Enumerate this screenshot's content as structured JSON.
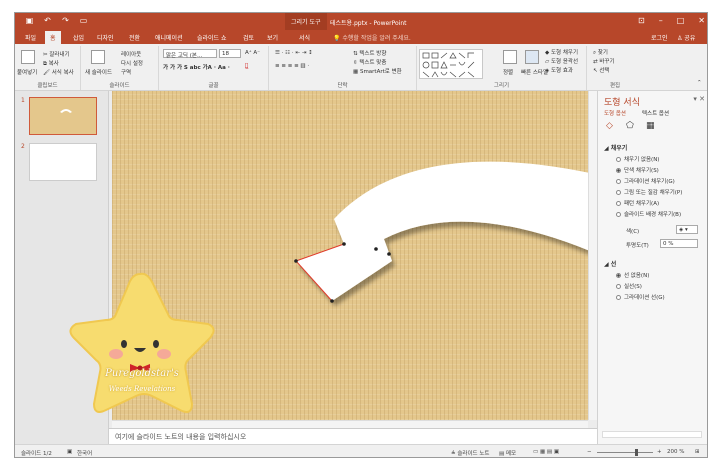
{
  "title_bar": {
    "context_tab": "그리기 도구",
    "doc_title": "테스트용.pptx - PowerPoint"
  },
  "tabs": [
    "파일",
    "홈",
    "삽입",
    "디자인",
    "전환",
    "애니메이션",
    "슬라이드 쇼",
    "검토",
    "보기",
    "서식"
  ],
  "active_tab": "홈",
  "tell_me": "수행할 작업을 알려 주세요.",
  "account": {
    "login": "로그인",
    "share": "공유"
  },
  "ribbon": {
    "clipboard": {
      "paste": "붙여넣기",
      "cut": "잘라내기",
      "copy": "복사",
      "format_painter": "서식 복사",
      "label": "클립보드"
    },
    "slides": {
      "new_slide": "새 슬라이드",
      "layout": "레이아웃",
      "reset": "다시 설정",
      "section": "구역",
      "label": "슬라이드"
    },
    "font": {
      "name": "맑은 고딕 (본…",
      "size": "18",
      "label": "글꼴"
    },
    "paragraph": {
      "text_direction": "텍스트 방향",
      "align_text": "텍스트 맞춤",
      "smartart": "SmartArt로 변환",
      "label": "단락"
    },
    "drawing": {
      "arrange": "정렬",
      "quick_styles": "빠른 스타일",
      "fill": "도형 채우기",
      "outline": "도형 윤곽선",
      "effects": "도형 효과",
      "label": "그리기"
    },
    "editing": {
      "find": "찾기",
      "replace": "바꾸기",
      "select": "선택",
      "label": "편집"
    }
  },
  "thumbnails": [
    {
      "num": "1"
    },
    {
      "num": "2"
    }
  ],
  "notes_placeholder": "여기에 슬라이드 노트의 내용을 입력하십시오",
  "format_pane": {
    "title": "도형 서식",
    "subtabs": [
      "도형 옵션",
      "텍스트 옵션"
    ],
    "fill_section": "채우기",
    "fill_options": [
      "채우기 없음(N)",
      "단색 채우기(S)",
      "그라데이션 채우기(G)",
      "그림 또는 질감 채우기(P)",
      "패턴 채우기(A)",
      "슬라이드 배경 채우기(B)"
    ],
    "fill_selected": 1,
    "color_label": "색(C)",
    "transparency_label": "투명도(T)",
    "transparency_value": "0 %",
    "line_section": "선",
    "line_options": [
      "선 없음(N)",
      "실선(S)",
      "그라데이션 선(G)"
    ],
    "line_selected": 0
  },
  "status": {
    "slide": "슬라이드 1/2",
    "language": "한국어",
    "notes": "슬라이드 노트",
    "comments": "메모",
    "zoom": "200 %"
  },
  "watermark": {
    "line1": "Puregoldstar's",
    "line2": "Weeds Revelations"
  },
  "colors": {
    "accent": "#b7472a",
    "slide_bg": "#e4c78c",
    "star": "#f7dc6f"
  }
}
